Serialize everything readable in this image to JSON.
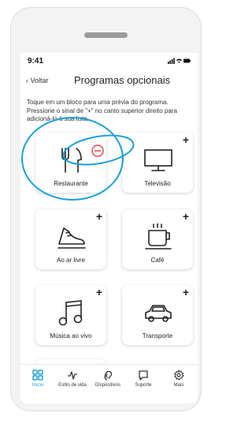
{
  "status_bar": {
    "time": "9:41",
    "icons": "signal wifi battery"
  },
  "header": {
    "back_label": "Voltar",
    "title": "Programas opcionais"
  },
  "instructions": "Toque em um bloco para uma prévia do programa. Pressione o sinal de \"+\" no canto superior direito para adicioná-lo à sua lista.",
  "cards": [
    {
      "label": "Restaurante",
      "icon": "fork-knife-icon",
      "action": "−"
    },
    {
      "label": "Televisão",
      "icon": "television-icon",
      "action": "+"
    },
    {
      "label": "Ao ar livre",
      "icon": "shoe-icon",
      "action": "+"
    },
    {
      "label": "Café",
      "icon": "coffee-cup-icon",
      "action": "+"
    },
    {
      "label": "Música ao vivo",
      "icon": "music-note-icon",
      "action": "+"
    },
    {
      "label": "Transporte",
      "icon": "car-icon",
      "action": "+"
    },
    {
      "label": "",
      "icon": "",
      "action": "+"
    }
  ],
  "tabbar": {
    "items": [
      {
        "label": "Início",
        "icon": "grid-icon",
        "active": true
      },
      {
        "label": "Estilo de vida",
        "icon": "activity-icon",
        "active": false
      },
      {
        "label": "Dispositivos",
        "icon": "hearing-aid-icon",
        "active": false
      },
      {
        "label": "Suporte",
        "icon": "chat-icon",
        "active": false
      },
      {
        "label": "Mais",
        "icon": "gear-icon",
        "active": false
      }
    ]
  },
  "colors": {
    "accent": "#1aa0d8",
    "remove": "#e0454a",
    "phone_frame": "#f3f3f3"
  }
}
